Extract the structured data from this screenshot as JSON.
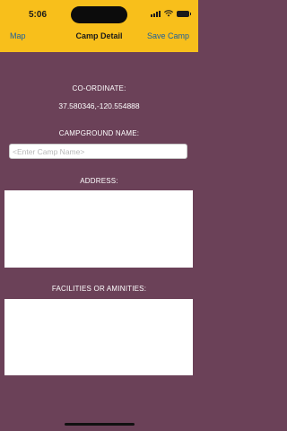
{
  "status_bar": {
    "time": "5:06"
  },
  "nav": {
    "back_label": "Map",
    "title": "Camp Detail",
    "save_label": "Save Camp"
  },
  "form": {
    "coordinate_label": "CO-ORDINATE:",
    "coordinate_value": "37.580346,-120.554888",
    "campground_label": "CAMPGROUND NAME:",
    "campground_placeholder": "<Enter Camp Name>",
    "address_label": "ADDRESS:",
    "facilities_label": "FACILITIES OR AMINITIES:"
  },
  "colors": {
    "background": "#6b4158",
    "header": "#f8bf1b",
    "link": "#1c5f9e"
  }
}
